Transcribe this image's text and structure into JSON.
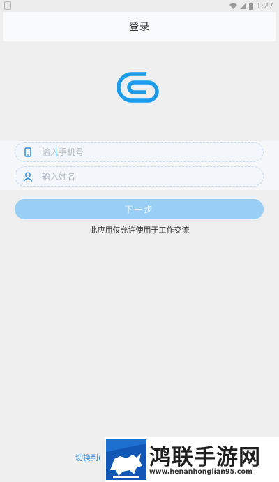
{
  "status_bar": {
    "time": "1:27"
  },
  "header": {
    "title": "登录"
  },
  "login": {
    "phone_placeholder": "输入手机号",
    "name_placeholder": "输入姓名",
    "next_label": "下一步",
    "notice": "此应用仅允许使用于工作交流",
    "switch_label": "切换到("
  },
  "watermark": {
    "text": "鸿联手游网",
    "url": "www.henanhonglian95.com"
  },
  "colors": {
    "accent": "#2a8de0",
    "button": "#99cff5",
    "background": "#efefef"
  },
  "icons": [
    "phone-icon",
    "user-icon",
    "app-logo"
  ]
}
